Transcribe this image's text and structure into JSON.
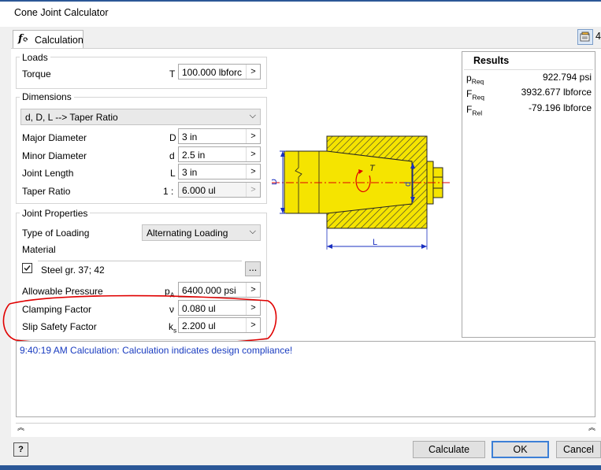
{
  "window": {
    "title": "Cone Joint Calculator"
  },
  "tabs": [
    {
      "label": "Calculation",
      "icon": "fx-icon"
    }
  ],
  "toolbar": {
    "right_number": "4"
  },
  "loads": {
    "group_title": "Loads",
    "torque": {
      "label": "Torque",
      "symbol": "T",
      "value": "100.000 lbforc"
    }
  },
  "dimensions": {
    "group_title": "Dimensions",
    "mode_select": "d, D, L --> Taper Ratio",
    "rows": [
      {
        "label": "Major Diameter",
        "symbol": "D",
        "value": "3 in"
      },
      {
        "label": "Minor Diameter",
        "symbol": "d",
        "value": "2.5 in"
      },
      {
        "label": "Joint Length",
        "symbol": "L",
        "value": "3 in"
      },
      {
        "label": "Taper Ratio",
        "symbol": "1 :",
        "value": "6.000 ul"
      }
    ]
  },
  "joint_properties": {
    "group_title": "Joint Properties",
    "type_of_loading_label": "Type of Loading",
    "type_of_loading_value": "Alternating Loading",
    "material_label": "Material",
    "material_checked": true,
    "material_value": "Steel gr. 37; 42",
    "material_browse": "...",
    "rows": [
      {
        "label": "Allowable Pressure",
        "symbol": "p",
        "symbol_sub": "A",
        "value": "6400.000 psi"
      },
      {
        "label": "Clamping Factor",
        "symbol": "ν",
        "symbol_sub": "",
        "value": "0.080 ul"
      },
      {
        "label": "Slip Safety Factor",
        "symbol": "k",
        "symbol_sub": "s",
        "value": "2.200 ul"
      }
    ]
  },
  "diagram": {
    "label_D": "D",
    "label_d": "d",
    "label_L": "L",
    "label_T": "T"
  },
  "results": {
    "title": "Results",
    "rows": [
      {
        "symbol": "p",
        "sub": "Req",
        "value": "922.794 psi"
      },
      {
        "symbol": "F",
        "sub": "Req",
        "value": "3932.677 lbforce"
      },
      {
        "symbol": "F",
        "sub": "Rel",
        "value": "-79.196 lbforce"
      }
    ]
  },
  "log": {
    "message": "9:40:19 AM Calculation: Calculation indicates design compliance!"
  },
  "buttons": {
    "help": "?",
    "calculate": "Calculate",
    "ok": "OK",
    "cancel": "Cancel"
  },
  "colors": {
    "accent": "#2b5797",
    "part_fill": "#f5e400",
    "annotation_red": "#e00000",
    "log_text": "#1a3cc0"
  }
}
